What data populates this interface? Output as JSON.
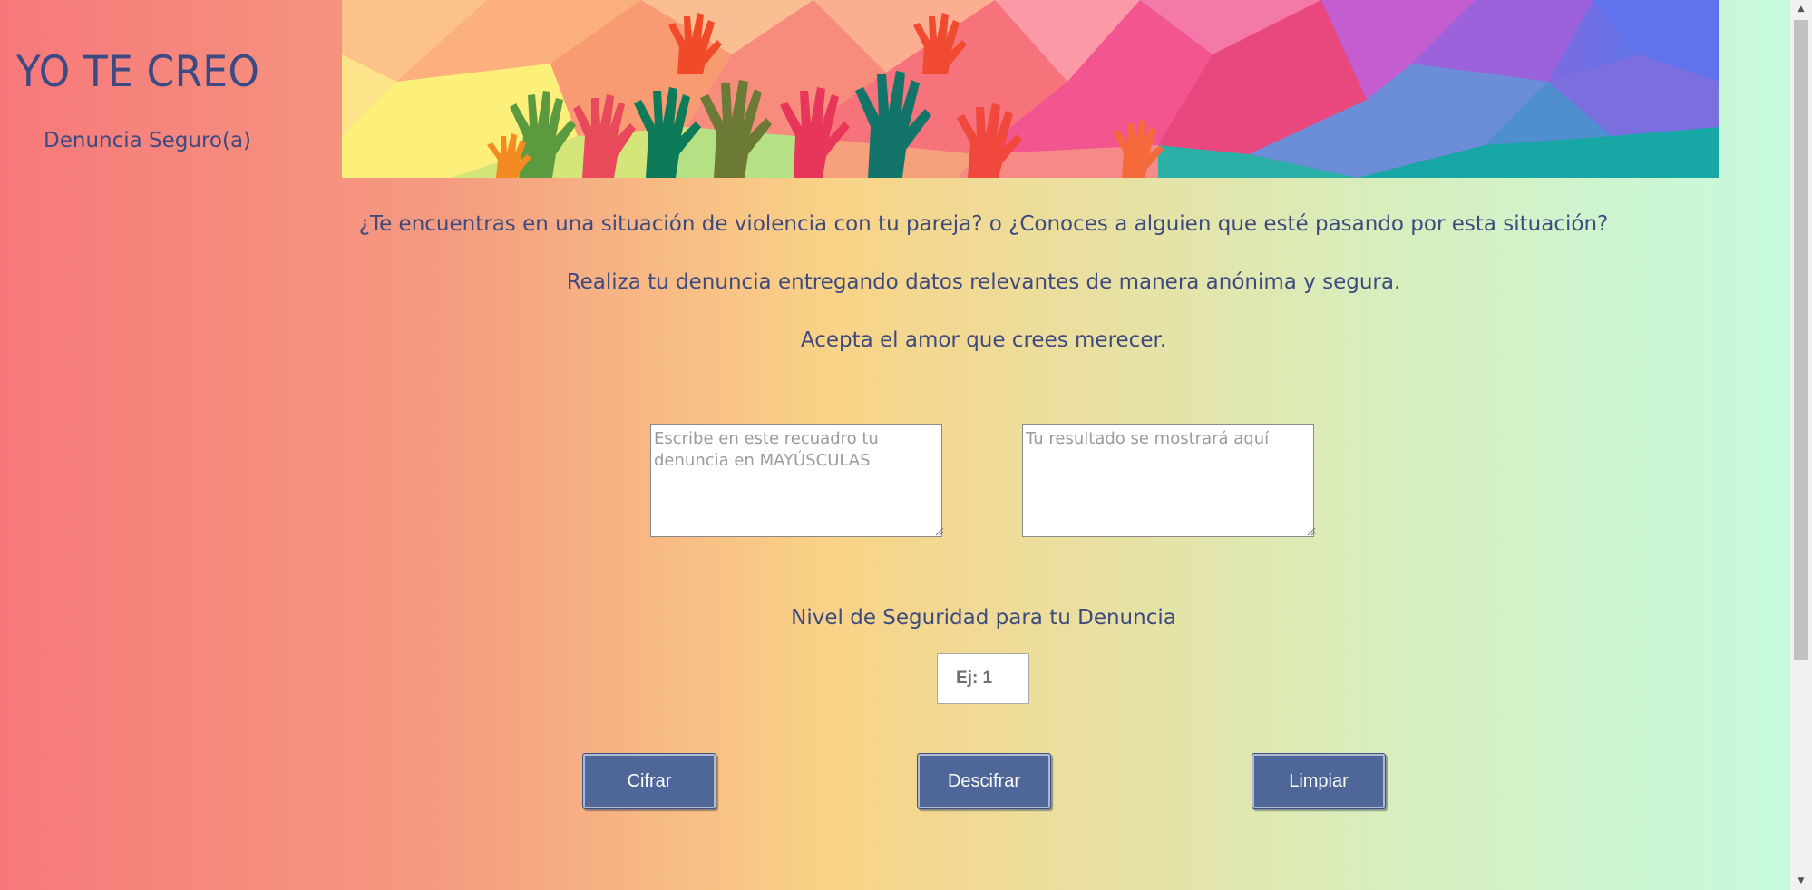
{
  "header": {
    "title": "YO TE CREO",
    "subtitle": "Denuncia Seguro(a)",
    "banner_icon": "raised-hands-banner"
  },
  "intro": {
    "line1": "¿Te encuentras en una situación de violencia con tu pareja? o ¿Conoces a alguien que esté pasando por esta situación?",
    "line2": "Realiza tu denuncia entregando datos relevantes de manera anónima y segura.",
    "line3": "Acepta el amor que crees merecer."
  },
  "form": {
    "input_value": "",
    "input_placeholder": "Escribe en este recuadro tu denuncia en MAYÚSCULAS",
    "output_value": "",
    "output_placeholder": "Tu resultado se mostrará aquí",
    "level_label": "Nivel de Seguridad para tu Denuncia",
    "level_value": "",
    "level_placeholder": "Ej: 1"
  },
  "buttons": {
    "encrypt": "Cifrar",
    "decrypt": "Descifrar",
    "clear": "Limpiar"
  },
  "colors": {
    "text": "#3d4a7e",
    "button": "#4f6699",
    "gradient_left": "#f7787a",
    "gradient_mid": "#f9d387",
    "gradient_right": "#c5fbe0"
  }
}
